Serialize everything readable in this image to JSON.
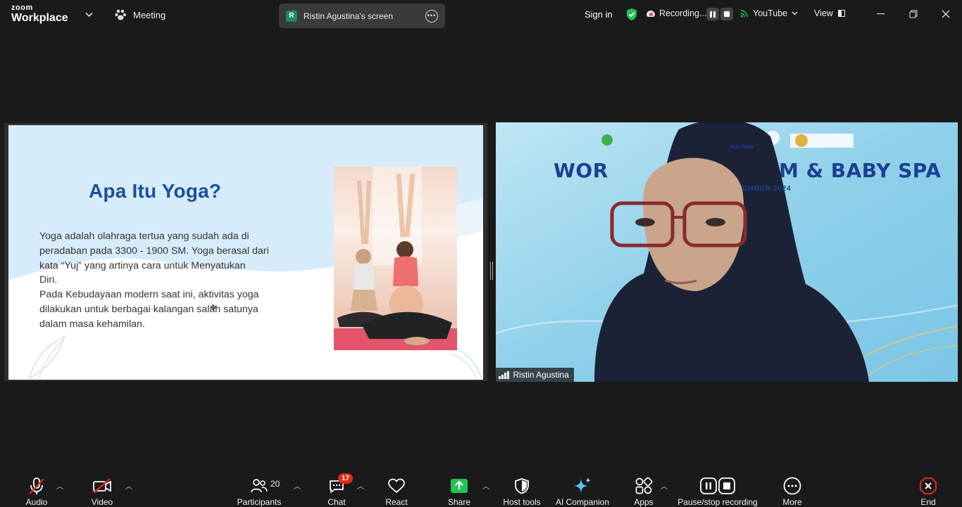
{
  "app": {
    "brand_top": "zoom",
    "brand_bottom": "Workplace"
  },
  "header": {
    "meeting_label": "Meeting",
    "screen_share_label": "Ristin Agustina's screen",
    "screen_share_initial": "R",
    "sign_in": "Sign in",
    "recording_label": "Recording...",
    "livestream_label": "YouTube",
    "view_label": "View"
  },
  "slide": {
    "title": "Apa Itu Yoga?",
    "body": [
      "Yoga adalah olahraga tertua yang sudah ada di",
      "peradaban pada 3300 - 1900 SM. Yoga berasal dari",
      "kata “Yuj” yang artinya cara untuk Menyatukan",
      "Diri.",
      "Pada Kebudayaan modern saat ini, aktivitas yoga",
      "dilakukan untuk berbagai kalangan salah satunya",
      "dalam masa kehamilan."
    ]
  },
  "video": {
    "participant_name": "Ristin Agustina",
    "banner_left": "WOR",
    "banner_right": "M & BABY SPA",
    "banner_date": "EMBER 2024",
    "logo_text": "HEALTHIRA"
  },
  "toolbar": {
    "audio": "Audio",
    "video": "Video",
    "participants": "Participants",
    "participants_count": "20",
    "chat": "Chat",
    "chat_badge": "17",
    "react": "React",
    "share": "Share",
    "host_tools": "Host tools",
    "ai_companion": "AI Companion",
    "apps": "Apps",
    "pause_stop_recording": "Pause/stop recording",
    "more": "More",
    "end": "End"
  },
  "colors": {
    "background": "#1a1a1a",
    "accent_green": "#23c552",
    "end_red": "#e0281e",
    "slide_title": "#1b4fa0"
  },
  "icons": [
    "chevron-down-icon",
    "meeting-icon",
    "more-icon",
    "shield-check-icon",
    "recording-cloud-icon",
    "pause-icon",
    "stop-icon",
    "signal-icon",
    "view-icon",
    "minimize-icon",
    "restore-icon",
    "close-icon",
    "mic-muted-icon",
    "camera-off-icon",
    "participants-icon",
    "chat-icon",
    "heart-icon",
    "share-arrow-icon",
    "shield-icon",
    "sparkle-icon",
    "apps-icon",
    "more-dots-icon",
    "end-icon"
  ]
}
